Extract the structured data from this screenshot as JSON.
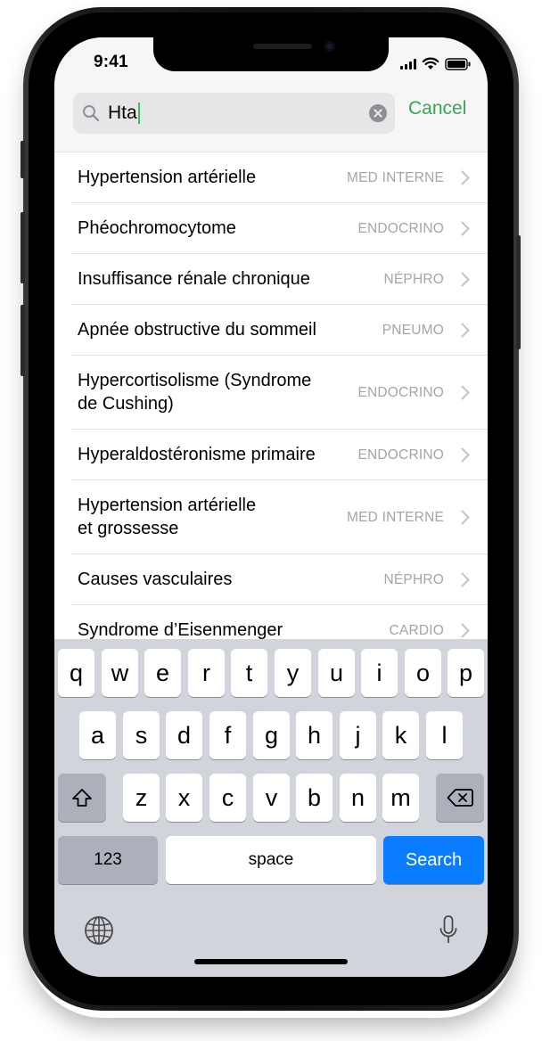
{
  "status_bar": {
    "time": "9:41",
    "icons": [
      "signal-icon",
      "wifi-icon",
      "battery-icon"
    ]
  },
  "search": {
    "value": "Hta",
    "cancel_label": "Cancel"
  },
  "results": [
    {
      "title": "Hypertension artérielle",
      "title_line2": "",
      "tag": "MED INTERNE"
    },
    {
      "title": "Phéochromocytome",
      "title_line2": "",
      "tag": "ENDOCRINO"
    },
    {
      "title": "Insuffisance rénale chronique",
      "title_line2": "",
      "tag": "NÉPHRO"
    },
    {
      "title": "Apnée obstructive du sommeil",
      "title_line2": "",
      "tag": "PNEUMO"
    },
    {
      "title": "Hypercortisolisme (Syndrome",
      "title_line2": "de Cushing)",
      "tag": "ENDOCRINO"
    },
    {
      "title": "Hyperaldostéronisme primaire",
      "title_line2": "",
      "tag": "ENDOCRINO"
    },
    {
      "title": "Hypertension artérielle",
      "title_line2": "et grossesse",
      "tag": "MED INTERNE"
    },
    {
      "title": "Causes vasculaires",
      "title_line2": "",
      "tag": "NÉPHRO"
    },
    {
      "title": "Syndrome d’Eisenmenger",
      "title_line2": "",
      "tag": "CARDIO"
    }
  ],
  "keyboard": {
    "row1": [
      "q",
      "w",
      "e",
      "r",
      "t",
      "y",
      "u",
      "i",
      "o",
      "p"
    ],
    "row2": [
      "a",
      "s",
      "d",
      "f",
      "g",
      "h",
      "j",
      "k",
      "l"
    ],
    "row3": [
      "z",
      "x",
      "c",
      "v",
      "b",
      "n",
      "m"
    ],
    "numbers_label": "123",
    "space_label": "space",
    "search_label": "Search"
  },
  "colors": {
    "accent": "#34a853",
    "search_key": "#0a7cff",
    "keyboard_bg": "#d1d4db"
  }
}
